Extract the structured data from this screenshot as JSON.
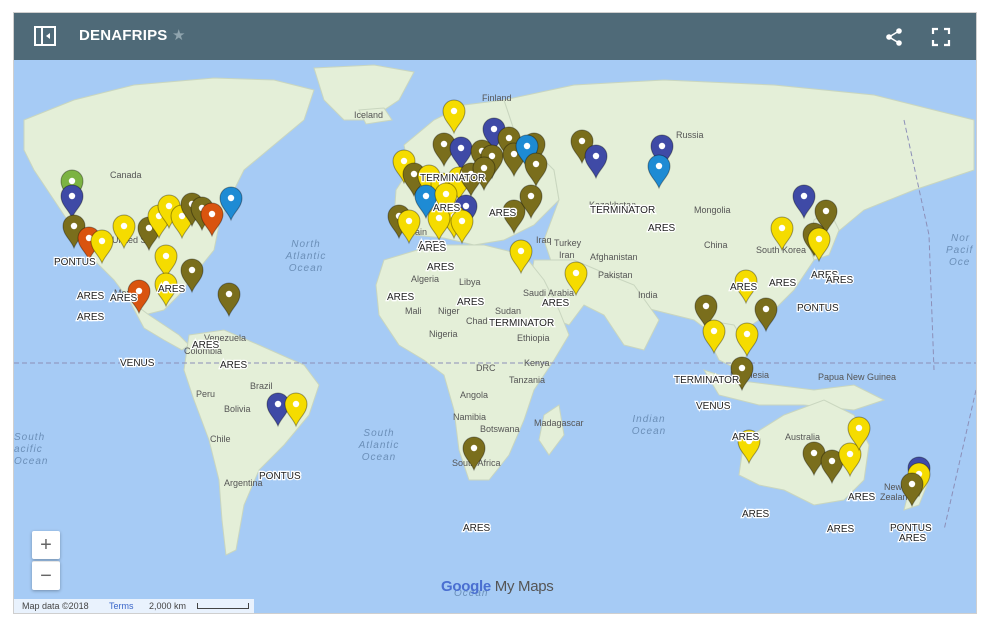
{
  "header": {
    "title": "DENAFRIPS"
  },
  "map": {
    "labels": {
      "iceland": "Iceland",
      "finland": "Finland",
      "russia": "Russia",
      "canada": "Canada",
      "kazakhstan": "Kazakhstan",
      "mongolia": "Mongolia",
      "china": "China",
      "south_korea": "South Korea",
      "north_atlantic": "North\nAtlantic\nOcean",
      "algeria": "Algeria",
      "libya": "Libya",
      "afghanistan": "Afghanistan",
      "pakistan": "Pakistan",
      "iraq": "Iraq",
      "iran": "Iran",
      "saudi_arabia": "Saudi Arabia",
      "india": "India",
      "mexico": "Mexico",
      "mali": "Mali",
      "niger": "Niger",
      "chad": "Chad",
      "sudan": "Sudan",
      "ethiopia": "Ethiopia",
      "nigeria": "Nigeria",
      "venezuela": "Venezuela",
      "colombia": "Colombia",
      "drc": "DRC",
      "kenya": "Kenya",
      "tanzania": "Tanzania",
      "indonesia": "Indonesia",
      "papua": "Papua New\nGuinea",
      "brazil": "Brazil",
      "peru": "Peru",
      "bolivia": "Bolivia",
      "angola": "Angola",
      "namibia": "Namibia",
      "botswana": "Botswana",
      "madagascar": "Madagascar",
      "chile": "Chile",
      "argentina": "Argentina",
      "australia": "Australia",
      "south_pacific": "South\nPacific\nOcean",
      "south_atlantic": "South\nAtlantic\nOcean",
      "indian_ocean": "Indian\nOcean",
      "north_pacific": "Nor\nPacif\nOce",
      "south_africa": "South Africa",
      "new_zealand": "New\nZealand",
      "united_states": "United St",
      "southern_ocean": "Ocean",
      "spain": "Spain",
      "turkey": "Turkey"
    },
    "pin_labels": [
      "TERMINATOR",
      "ARES",
      "ARES",
      "ARES",
      "PONTUS",
      "ARES",
      "ARES",
      "ARES",
      "ARES",
      "ARES",
      "ARES",
      "VENUS",
      "ARES",
      "ARES",
      "ARES",
      "TERMINATOR",
      "ARES",
      "ARES",
      "TERMINATOR",
      "ARES",
      "ARES",
      "PONTUS",
      "TERMINATOR",
      "VENUS",
      "ARES",
      "PONTUS",
      "ARES",
      "ARES",
      "ARES",
      "ARES",
      "PONTUS",
      "ARES",
      "ARES",
      "ARES",
      "ARES"
    ]
  },
  "controls": {
    "zoom_in": "+",
    "zoom_out": "−"
  },
  "footer": {
    "map_data": "Map data ©2018",
    "terms": "Terms",
    "scale": "2,000 km"
  },
  "watermark": {
    "google": "Google",
    "my_maps": "My Maps"
  },
  "colors": {
    "yellow": "#f5dc00",
    "olive": "#7a6e1c",
    "blue": "#3f4aa6",
    "light_blue": "#1e8bd4",
    "orange": "#d9540f",
    "green": "#7cb342",
    "header": "#4f6a78",
    "water": "#a6cbf5",
    "land": "#e4efd8"
  }
}
